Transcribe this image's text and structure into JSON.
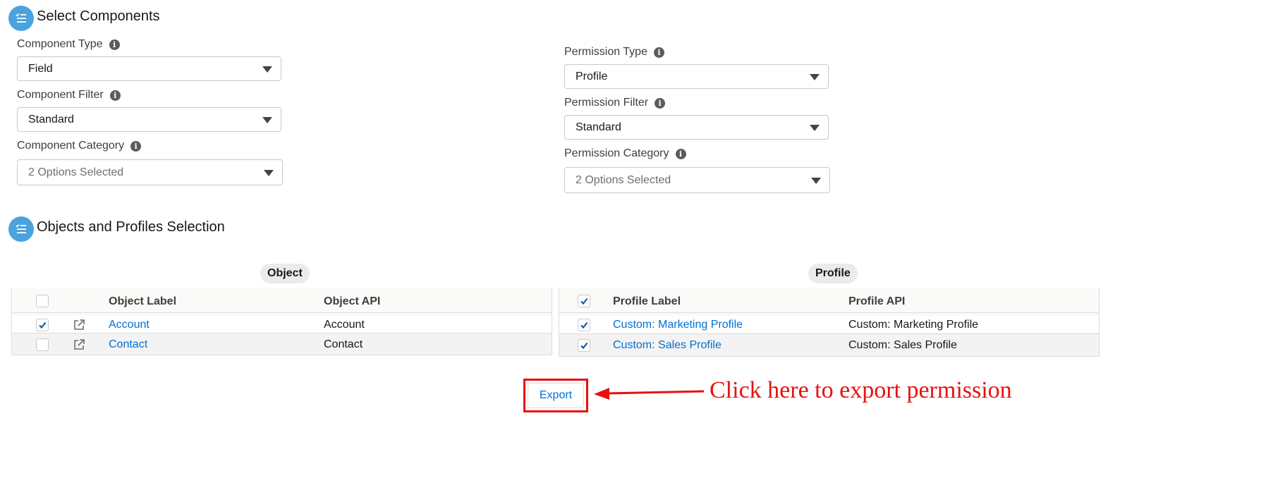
{
  "select_components": {
    "title": "Select Components",
    "component_type": {
      "label": "Component Type",
      "value": "Field"
    },
    "component_filter": {
      "label": "Component Filter",
      "value": "Standard"
    },
    "component_category": {
      "label": "Component Category",
      "value": "2 Options Selected"
    },
    "permission_type": {
      "label": "Permission Type",
      "value": "Profile"
    },
    "permission_filter": {
      "label": "Permission Filter",
      "value": "Standard"
    },
    "permission_category": {
      "label": "Permission Category",
      "value": "2 Options Selected"
    }
  },
  "selection": {
    "title": "Objects and Profiles Selection",
    "object_table": {
      "pill": "Object",
      "headers": {
        "label": "Object Label",
        "api": "Object API"
      },
      "rows": [
        {
          "label": "Account",
          "api": "Account",
          "checked": true
        },
        {
          "label": "Contact",
          "api": "Contact",
          "checked": false
        }
      ]
    },
    "profile_table": {
      "pill": "Profile",
      "headers": {
        "label": "Profile Label",
        "api": "Profile API"
      },
      "rows": [
        {
          "label": "Custom: Marketing Profile",
          "api": "Custom: Marketing Profile",
          "checked": true
        },
        {
          "label": "Custom: Sales Profile",
          "api": "Custom: Sales Profile",
          "checked": true
        }
      ]
    }
  },
  "export": {
    "button_label": "Export",
    "annotation": "Click here to export permission"
  },
  "colors": {
    "accent": "#0070d2",
    "section_icon": "#4aa3df",
    "annotation_red": "#e8100f"
  },
  "icons": {
    "section": "list-check-icon",
    "info": "info-icon",
    "dropdown": "caret-down-icon",
    "open": "external-link-icon",
    "check": "checkmark-icon"
  }
}
